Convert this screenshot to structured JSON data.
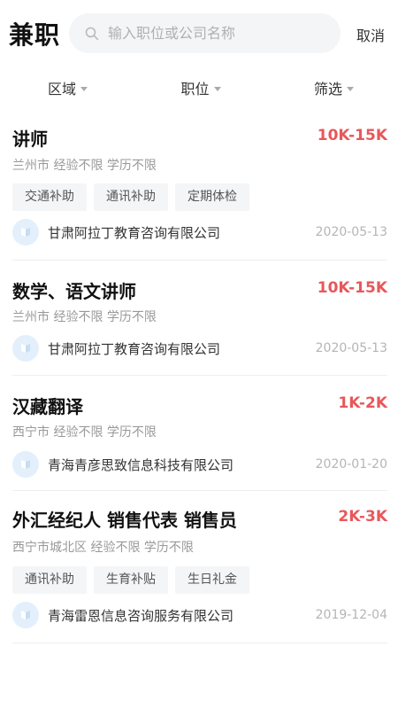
{
  "header": {
    "title": "兼职",
    "search_placeholder": "输入职位或公司名称",
    "cancel_label": "取消"
  },
  "filters": [
    {
      "label": "区域"
    },
    {
      "label": "职位"
    },
    {
      "label": "筛选"
    }
  ],
  "jobs": [
    {
      "title": "讲师",
      "salary": "10K-15K",
      "meta": "兰州市 经验不限 学历不限",
      "tags": [
        "交通补助",
        "通讯补助",
        "定期体检"
      ],
      "company": "甘肃阿拉丁教育咨询有限公司",
      "date": "2020-05-13"
    },
    {
      "title": "数学、语文讲师",
      "salary": "10K-15K",
      "meta": "兰州市 经验不限 学历不限",
      "tags": [],
      "company": "甘肃阿拉丁教育咨询有限公司",
      "date": "2020-05-13"
    },
    {
      "title": "汉藏翻译",
      "salary": "1K-2K",
      "meta": "西宁市 经验不限 学历不限",
      "tags": [],
      "company": "青海青彦思致信息科技有限公司",
      "date": "2020-01-20"
    },
    {
      "title": "外汇经纪人 销售代表 销售员",
      "salary": "2K-3K",
      "meta": "西宁市城北区 经验不限 学历不限",
      "tags": [
        "通讯补助",
        "生育补贴",
        "生日礼金"
      ],
      "company": "青海雷恩信息咨询服务有限公司",
      "date": "2019-12-04"
    }
  ],
  "colors": {
    "salary": "#e8575a",
    "tag_bg": "#f4f5f7",
    "logo_bg": "#e3f0fb"
  }
}
